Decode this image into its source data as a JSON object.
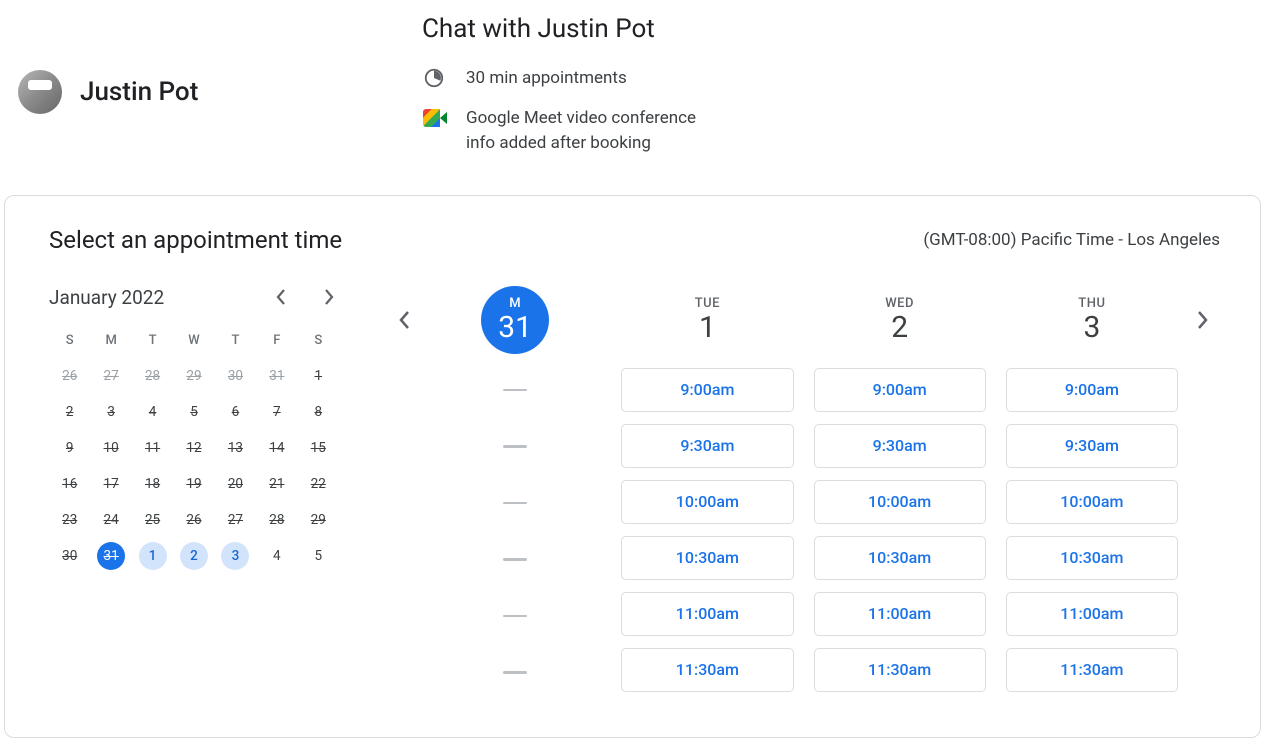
{
  "profile": {
    "name": "Justin Pot"
  },
  "event": {
    "title": "Chat with Justin Pot",
    "duration": "30 min appointments",
    "meet_line1": "Google Meet video conference",
    "meet_line2": "info added after booking"
  },
  "card": {
    "select_title": "Select an appointment time",
    "timezone": "(GMT-08:00) Pacific Time - Los Angeles"
  },
  "mini_cal": {
    "title": "January 2022",
    "dow": [
      "S",
      "M",
      "T",
      "W",
      "T",
      "F",
      "S"
    ],
    "weeks": [
      [
        {
          "n": "26",
          "state": "out"
        },
        {
          "n": "27",
          "state": "out"
        },
        {
          "n": "28",
          "state": "out"
        },
        {
          "n": "29",
          "state": "out"
        },
        {
          "n": "30",
          "state": "out"
        },
        {
          "n": "31",
          "state": "out"
        },
        {
          "n": "1",
          "state": "past"
        }
      ],
      [
        {
          "n": "2",
          "state": "past"
        },
        {
          "n": "3",
          "state": "past"
        },
        {
          "n": "4",
          "state": "past"
        },
        {
          "n": "5",
          "state": "past"
        },
        {
          "n": "6",
          "state": "past"
        },
        {
          "n": "7",
          "state": "past"
        },
        {
          "n": "8",
          "state": "past"
        }
      ],
      [
        {
          "n": "9",
          "state": "past"
        },
        {
          "n": "10",
          "state": "past"
        },
        {
          "n": "11",
          "state": "past"
        },
        {
          "n": "12",
          "state": "past"
        },
        {
          "n": "13",
          "state": "past"
        },
        {
          "n": "14",
          "state": "past"
        },
        {
          "n": "15",
          "state": "past"
        }
      ],
      [
        {
          "n": "16",
          "state": "past"
        },
        {
          "n": "17",
          "state": "past"
        },
        {
          "n": "18",
          "state": "past"
        },
        {
          "n": "19",
          "state": "past"
        },
        {
          "n": "20",
          "state": "past"
        },
        {
          "n": "21",
          "state": "past"
        },
        {
          "n": "22",
          "state": "past"
        }
      ],
      [
        {
          "n": "23",
          "state": "past"
        },
        {
          "n": "24",
          "state": "past"
        },
        {
          "n": "25",
          "state": "past"
        },
        {
          "n": "26",
          "state": "past"
        },
        {
          "n": "27",
          "state": "past"
        },
        {
          "n": "28",
          "state": "past"
        },
        {
          "n": "29",
          "state": "past"
        }
      ],
      [
        {
          "n": "30",
          "state": "past"
        },
        {
          "n": "31",
          "state": "selected"
        },
        {
          "n": "1",
          "state": "available"
        },
        {
          "n": "2",
          "state": "available"
        },
        {
          "n": "3",
          "state": "available"
        },
        {
          "n": "4",
          "state": "none"
        },
        {
          "n": "5",
          "state": "none"
        }
      ]
    ]
  },
  "slots": {
    "days": [
      {
        "dow": "M",
        "num": "31",
        "selected": true,
        "times": []
      },
      {
        "dow": "TUE",
        "num": "1",
        "selected": false,
        "times": [
          "9:00am",
          "9:30am",
          "10:00am",
          "10:30am",
          "11:00am",
          "11:30am"
        ]
      },
      {
        "dow": "WED",
        "num": "2",
        "selected": false,
        "times": [
          "9:00am",
          "9:30am",
          "10:00am",
          "10:30am",
          "11:00am",
          "11:30am"
        ]
      },
      {
        "dow": "THU",
        "num": "3",
        "selected": false,
        "times": [
          "9:00am",
          "9:30am",
          "10:00am",
          "10:30am",
          "11:00am",
          "11:30am"
        ]
      }
    ],
    "empty_rows": 6
  }
}
